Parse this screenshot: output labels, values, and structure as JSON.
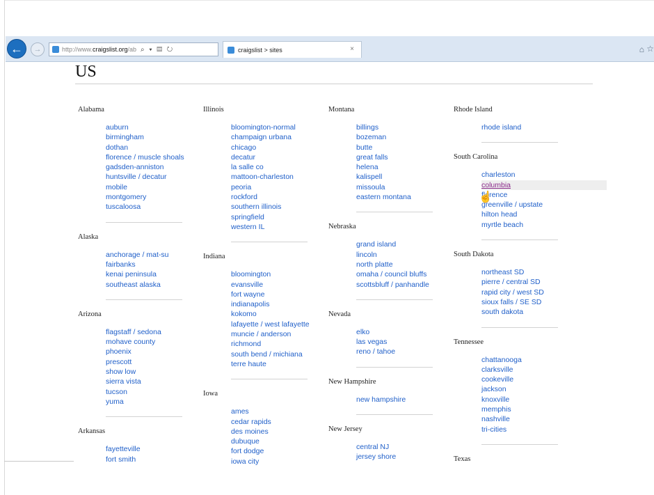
{
  "browser": {
    "url_gray": "http://www.",
    "url_dark": "craigslist.org",
    "url_rest": "/ab",
    "address_tools": "⌕ ▾ ▤ ↻",
    "tab_title": "craigslist > sites",
    "icons": [
      "back-icon",
      "forward-icon",
      "page-icon",
      "close-icon",
      "home-icon",
      "star-icon"
    ]
  },
  "page": {
    "title": "US",
    "link_color": "#1f5fc9",
    "visited_color": "#8a2a8a",
    "columns": [
      [
        {
          "state": "Alabama",
          "cities": [
            "auburn",
            "birmingham",
            "dothan",
            "florence / muscle shoals",
            "gadsden-anniston",
            "huntsville / decatur",
            "mobile",
            "montgomery",
            "tuscaloosa"
          ]
        },
        {
          "state": "Alaska",
          "cities": [
            "anchorage / mat-su",
            "fairbanks",
            "kenai peninsula",
            "southeast alaska"
          ]
        },
        {
          "state": "Arizona",
          "cities": [
            "flagstaff / sedona",
            "mohave county",
            "phoenix",
            "prescott",
            "show low",
            "sierra vista",
            "tucson",
            "yuma"
          ]
        },
        {
          "state": "Arkansas",
          "cities": [
            "fayetteville",
            "fort smith"
          ]
        }
      ],
      [
        {
          "state": "Illinois",
          "cities": [
            "bloomington-normal",
            "champaign urbana",
            "chicago",
            "decatur",
            "la salle co",
            "mattoon-charleston",
            "peoria",
            "rockford",
            "southern illinois",
            "springfield",
            "western IL"
          ]
        },
        {
          "state": "Indiana",
          "cities": [
            "bloomington",
            "evansville",
            "fort wayne",
            "indianapolis",
            "kokomo",
            "lafayette / west lafayette",
            "muncie / anderson",
            "richmond",
            "south bend / michiana",
            "terre haute"
          ]
        },
        {
          "state": "Iowa",
          "cities": [
            "ames",
            "cedar rapids",
            "des moines",
            "dubuque",
            "fort dodge",
            "iowa city"
          ]
        }
      ],
      [
        {
          "state": "Montana",
          "cities": [
            "billings",
            "bozeman",
            "butte",
            "great falls",
            "helena",
            "kalispell",
            "missoula",
            "eastern montana"
          ]
        },
        {
          "state": "Nebraska",
          "cities": [
            "grand island",
            "lincoln",
            "north platte",
            "omaha / council bluffs",
            "scottsbluff / panhandle"
          ]
        },
        {
          "state": "Nevada",
          "cities": [
            "elko",
            "las vegas",
            "reno / tahoe"
          ]
        },
        {
          "state": "New Hampshire",
          "cities": [
            "new hampshire"
          ]
        },
        {
          "state": "New Jersey",
          "cities": [
            "central NJ",
            "jersey shore"
          ]
        }
      ],
      [
        {
          "state": "Rhode Island",
          "cities": [
            "rhode island"
          ]
        },
        {
          "state": "South Carolina",
          "cities": [
            "charleston",
            "columbia",
            "florence",
            "greenville / upstate",
            "hilton head",
            "myrtle beach"
          ],
          "highlight_index": 1
        },
        {
          "state": "South Dakota",
          "cities": [
            "northeast SD",
            "pierre / central SD",
            "rapid city / west SD",
            "sioux falls / SE SD",
            "south dakota"
          ]
        },
        {
          "state": "Tennessee",
          "cities": [
            "chattanooga",
            "clarksville",
            "cookeville",
            "jackson",
            "knoxville",
            "memphis",
            "nashville",
            "tri-cities"
          ]
        },
        {
          "state": "Texas",
          "cities": []
        }
      ]
    ]
  }
}
